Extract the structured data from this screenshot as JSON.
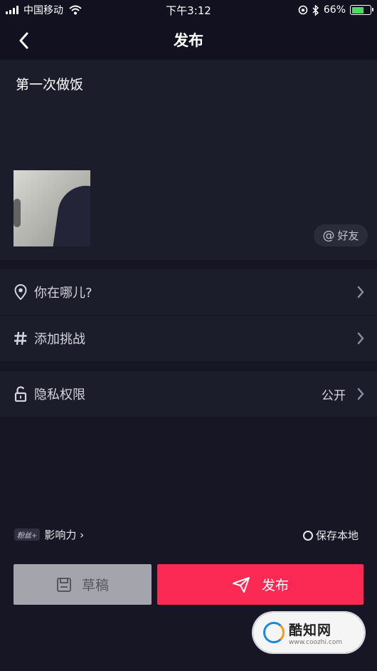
{
  "status_bar": {
    "carrier": "中国移动",
    "time": "下午3:12",
    "battery": "66%",
    "battery_level": 0.66
  },
  "nav": {
    "title": "发布"
  },
  "compose": {
    "caption": "第一次做饭",
    "mention_label": "好友",
    "mention_symbol": "@"
  },
  "rows": {
    "location": {
      "label": "你在哪儿?"
    },
    "challenge": {
      "label": "添加挑战"
    },
    "privacy": {
      "label": "隐私权限",
      "value": "公开"
    }
  },
  "footer": {
    "fans_badge": "粉丝+",
    "influence_label": "影响力 ›",
    "save_local_label": "保存本地",
    "draft_label": "草稿",
    "publish_label": "发布"
  },
  "watermark": {
    "name": "酷知网",
    "url": "www.coozhi.com"
  },
  "colors": {
    "background": "#161624",
    "panel": "#1b1d2a",
    "publish_accent": "#fa2a55",
    "draft_button": "#a4a5ac"
  }
}
